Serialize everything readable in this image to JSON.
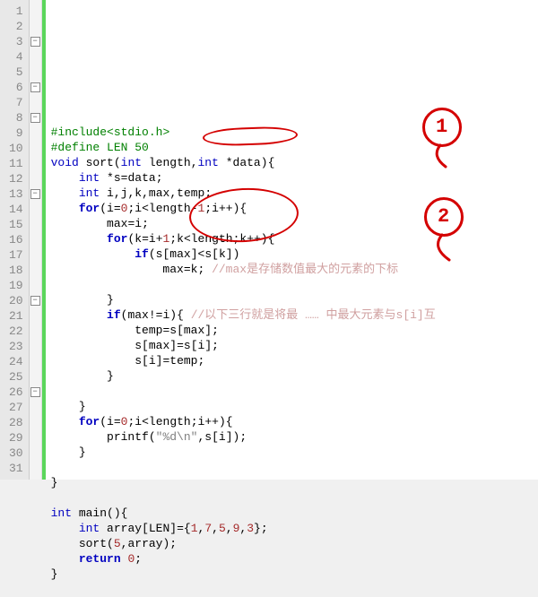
{
  "lines": [
    {
      "n": 1,
      "fold": null,
      "tokens": [
        [
          "pre",
          "#include"
        ],
        [
          "pre",
          "<stdio.h>"
        ]
      ]
    },
    {
      "n": 2,
      "fold": null,
      "tokens": [
        [
          "pre",
          "#define LEN 50"
        ]
      ]
    },
    {
      "n": 3,
      "fold": "box",
      "tokens": [
        [
          "type",
          "void "
        ],
        [
          "ident",
          "sort"
        ],
        [
          "op",
          "("
        ],
        [
          "type",
          "int "
        ],
        [
          "ident",
          "length"
        ],
        [
          "op",
          ","
        ],
        [
          "type",
          "int "
        ],
        [
          "op",
          "*"
        ],
        [
          "ident",
          "data"
        ],
        [
          "op",
          ")"
        ],
        [
          "brace",
          "{"
        ]
      ]
    },
    {
      "n": 4,
      "fold": null,
      "tokens": [
        [
          "ident",
          "    "
        ],
        [
          "type",
          "int "
        ],
        [
          "op",
          "*"
        ],
        [
          "ident",
          "s"
        ],
        [
          "op",
          "="
        ],
        [
          "ident",
          "data"
        ],
        [
          "op",
          ";"
        ]
      ]
    },
    {
      "n": 5,
      "fold": null,
      "tokens": [
        [
          "ident",
          "    "
        ],
        [
          "type",
          "int "
        ],
        [
          "ident",
          "i"
        ],
        [
          "op",
          ","
        ],
        [
          "ident",
          "j"
        ],
        [
          "op",
          ","
        ],
        [
          "ident",
          "k"
        ],
        [
          "op",
          ","
        ],
        [
          "ident",
          "max"
        ],
        [
          "op",
          ","
        ],
        [
          "ident",
          "temp"
        ],
        [
          "op",
          ";"
        ]
      ]
    },
    {
      "n": 6,
      "fold": "box",
      "tokens": [
        [
          "ident",
          "    "
        ],
        [
          "kw",
          "for"
        ],
        [
          "op",
          "("
        ],
        [
          "ident",
          "i"
        ],
        [
          "op",
          "="
        ],
        [
          "num",
          "0"
        ],
        [
          "op",
          ";"
        ],
        [
          "ident",
          "i"
        ],
        [
          "op",
          "<"
        ],
        [
          "ident",
          "length"
        ],
        [
          "op",
          "-"
        ],
        [
          "num",
          "1"
        ],
        [
          "op",
          ";"
        ],
        [
          "ident",
          "i"
        ],
        [
          "op",
          "++"
        ],
        [
          "op",
          ")"
        ],
        [
          "brace",
          "{"
        ]
      ]
    },
    {
      "n": 7,
      "fold": null,
      "tokens": [
        [
          "ident",
          "        max"
        ],
        [
          "op",
          "="
        ],
        [
          "ident",
          "i"
        ],
        [
          "op",
          ";"
        ]
      ]
    },
    {
      "n": 8,
      "fold": "box",
      "tokens": [
        [
          "ident",
          "        "
        ],
        [
          "kw",
          "for"
        ],
        [
          "op",
          "("
        ],
        [
          "ident",
          "k"
        ],
        [
          "op",
          "="
        ],
        [
          "ident",
          "i"
        ],
        [
          "op",
          "+"
        ],
        [
          "num",
          "1"
        ],
        [
          "op",
          ";"
        ],
        [
          "ident",
          "k"
        ],
        [
          "op",
          "<"
        ],
        [
          "ident",
          "length"
        ],
        [
          "op",
          ";"
        ],
        [
          "ident",
          "k"
        ],
        [
          "op",
          "++"
        ],
        [
          "op",
          ")"
        ],
        [
          "brace",
          "{"
        ]
      ]
    },
    {
      "n": 9,
      "fold": null,
      "tokens": [
        [
          "ident",
          "            "
        ],
        [
          "kw",
          "if"
        ],
        [
          "op",
          "("
        ],
        [
          "ident",
          "s"
        ],
        [
          "op",
          "["
        ],
        [
          "ident",
          "max"
        ],
        [
          "op",
          "]"
        ],
        [
          "op",
          "<"
        ],
        [
          "ident",
          "s"
        ],
        [
          "op",
          "["
        ],
        [
          "ident",
          "k"
        ],
        [
          "op",
          "]"
        ],
        [
          "op",
          ")"
        ]
      ]
    },
    {
      "n": 10,
      "fold": null,
      "tokens": [
        [
          "ident",
          "                max"
        ],
        [
          "op",
          "="
        ],
        [
          "ident",
          "k"
        ],
        [
          "op",
          ";"
        ],
        [
          "commcn",
          " //max是存储数值最大的元素的下标"
        ]
      ]
    },
    {
      "n": 11,
      "fold": null,
      "tokens": [
        [
          "ident",
          ""
        ]
      ]
    },
    {
      "n": 12,
      "fold": null,
      "tokens": [
        [
          "ident",
          "        "
        ],
        [
          "brace",
          "}"
        ]
      ]
    },
    {
      "n": 13,
      "fold": "box",
      "tokens": [
        [
          "ident",
          "        "
        ],
        [
          "kw",
          "if"
        ],
        [
          "op",
          "("
        ],
        [
          "ident",
          "max"
        ],
        [
          "op",
          "!="
        ],
        [
          "ident",
          "i"
        ],
        [
          "op",
          ")"
        ],
        [
          "brace",
          "{"
        ],
        [
          "commcn",
          " //以下三行就是将最 …… 中最大元素与s[i]互"
        ]
      ]
    },
    {
      "n": 14,
      "fold": null,
      "tokens": [
        [
          "ident",
          "            temp"
        ],
        [
          "op",
          "="
        ],
        [
          "ident",
          "s"
        ],
        [
          "op",
          "["
        ],
        [
          "ident",
          "max"
        ],
        [
          "op",
          "]"
        ],
        [
          "op",
          ";"
        ]
      ]
    },
    {
      "n": 15,
      "fold": null,
      "tokens": [
        [
          "ident",
          "            s"
        ],
        [
          "op",
          "["
        ],
        [
          "ident",
          "max"
        ],
        [
          "op",
          "]"
        ],
        [
          "op",
          "="
        ],
        [
          "ident",
          "s"
        ],
        [
          "op",
          "["
        ],
        [
          "ident",
          "i"
        ],
        [
          "op",
          "]"
        ],
        [
          "op",
          ";"
        ]
      ]
    },
    {
      "n": 16,
      "fold": null,
      "tokens": [
        [
          "ident",
          "            s"
        ],
        [
          "op",
          "["
        ],
        [
          "ident",
          "i"
        ],
        [
          "op",
          "]"
        ],
        [
          "op",
          "="
        ],
        [
          "ident",
          "temp"
        ],
        [
          "op",
          ";"
        ]
      ]
    },
    {
      "n": 17,
      "fold": null,
      "tokens": [
        [
          "ident",
          "        "
        ],
        [
          "brace",
          "}"
        ]
      ]
    },
    {
      "n": 18,
      "fold": null,
      "tokens": [
        [
          "ident",
          ""
        ]
      ]
    },
    {
      "n": 19,
      "fold": null,
      "tokens": [
        [
          "ident",
          "    "
        ],
        [
          "brace",
          "}"
        ]
      ]
    },
    {
      "n": 20,
      "fold": "box",
      "tokens": [
        [
          "ident",
          "    "
        ],
        [
          "kw",
          "for"
        ],
        [
          "op",
          "("
        ],
        [
          "ident",
          "i"
        ],
        [
          "op",
          "="
        ],
        [
          "num",
          "0"
        ],
        [
          "op",
          ";"
        ],
        [
          "ident",
          "i"
        ],
        [
          "op",
          "<"
        ],
        [
          "ident",
          "length"
        ],
        [
          "op",
          ";"
        ],
        [
          "ident",
          "i"
        ],
        [
          "op",
          "++"
        ],
        [
          "op",
          ")"
        ],
        [
          "brace",
          "{"
        ]
      ]
    },
    {
      "n": 21,
      "fold": null,
      "tokens": [
        [
          "ident",
          "        "
        ],
        [
          "ident",
          "printf"
        ],
        [
          "op",
          "("
        ],
        [
          "str",
          "\"%d\\n\""
        ],
        [
          "op",
          ","
        ],
        [
          "ident",
          "s"
        ],
        [
          "op",
          "["
        ],
        [
          "ident",
          "i"
        ],
        [
          "op",
          "]"
        ],
        [
          "op",
          ")"
        ],
        [
          "op",
          ";"
        ]
      ]
    },
    {
      "n": 22,
      "fold": null,
      "tokens": [
        [
          "ident",
          "    "
        ],
        [
          "brace",
          "}"
        ]
      ]
    },
    {
      "n": 23,
      "fold": null,
      "tokens": [
        [
          "ident",
          ""
        ]
      ]
    },
    {
      "n": 24,
      "fold": null,
      "tokens": [
        [
          "brace",
          "}"
        ]
      ]
    },
    {
      "n": 25,
      "fold": null,
      "tokens": [
        [
          "ident",
          ""
        ]
      ]
    },
    {
      "n": 26,
      "fold": "box",
      "tokens": [
        [
          "type",
          "int "
        ],
        [
          "ident",
          "main"
        ],
        [
          "op",
          "()"
        ],
        [
          "brace",
          "{"
        ]
      ]
    },
    {
      "n": 27,
      "fold": null,
      "tokens": [
        [
          "ident",
          "    "
        ],
        [
          "type",
          "int "
        ],
        [
          "ident",
          "array"
        ],
        [
          "op",
          "["
        ],
        [
          "ident",
          "LEN"
        ],
        [
          "op",
          "]"
        ],
        [
          "op",
          "="
        ],
        [
          "brace",
          "{"
        ],
        [
          "num",
          "1"
        ],
        [
          "op",
          ","
        ],
        [
          "num",
          "7"
        ],
        [
          "op",
          ","
        ],
        [
          "num",
          "5"
        ],
        [
          "op",
          ","
        ],
        [
          "num",
          "9"
        ],
        [
          "op",
          ","
        ],
        [
          "num",
          "3"
        ],
        [
          "brace",
          "}"
        ],
        [
          "op",
          ";"
        ]
      ]
    },
    {
      "n": 28,
      "fold": null,
      "tokens": [
        [
          "ident",
          "    sort"
        ],
        [
          "op",
          "("
        ],
        [
          "num",
          "5"
        ],
        [
          "op",
          ","
        ],
        [
          "ident",
          "array"
        ],
        [
          "op",
          ")"
        ],
        [
          "op",
          ";"
        ]
      ]
    },
    {
      "n": 29,
      "fold": null,
      "tokens": [
        [
          "ident",
          "    "
        ],
        [
          "kw",
          "return "
        ],
        [
          "num",
          "0"
        ],
        [
          "op",
          ";"
        ]
      ]
    },
    {
      "n": 30,
      "fold": null,
      "tokens": [
        [
          "brace",
          "}"
        ]
      ]
    },
    {
      "n": 31,
      "fold": null,
      "tokens": [
        [
          "ident",
          ""
        ]
      ]
    }
  ],
  "annotations": {
    "badge1": "1",
    "badge2": "2"
  }
}
